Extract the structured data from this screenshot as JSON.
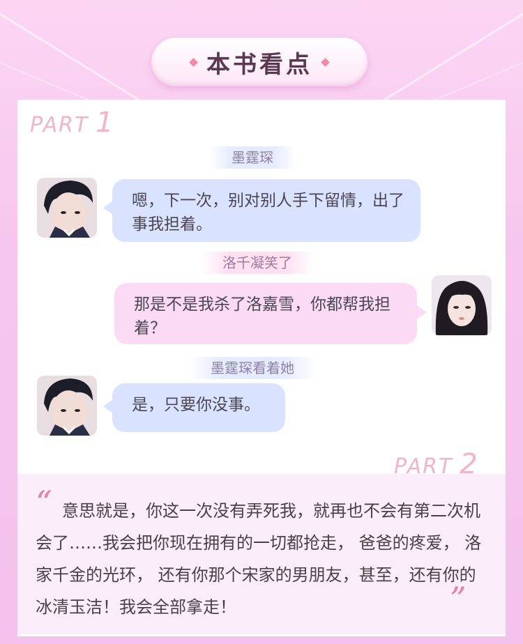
{
  "header": {
    "title": "本书看点"
  },
  "part1": {
    "label": "PART",
    "number": "1",
    "dialogues": [
      {
        "speaker_tag": "墨霆琛",
        "text": "嗯，下一次，别对别人手下留情，出了事我担着。",
        "side": "left",
        "avatar": "male-avatar"
      },
      {
        "speaker_tag": "洛千凝笑了",
        "text": "那是不是我杀了洛嘉雪，你都帮我担着？",
        "side": "right",
        "avatar": "female-avatar"
      },
      {
        "speaker_tag": "墨霆琛看着她",
        "text": "是，只要你没事。",
        "side": "left",
        "avatar": "male-avatar"
      }
    ]
  },
  "part2": {
    "label": "PART",
    "number": "2",
    "quote_open": "“",
    "quote_close": "”",
    "quote": "意思就是，你这一次没有弄死我，就再也不会有第二次机会了……我会把你现在拥有的一切都抢走， 爸爸的疼爱， 洛家千金的光环， 还有你那个宋家的男朋友，甚至，还有你的冰清玉洁！我会全部拿走！"
  },
  "colors": {
    "background": "#f6c6ee",
    "bubble_blue": "#d9e3ff",
    "bubble_pink": "#fbdaf3",
    "part_label": "#f3b3c8",
    "quote_mark": "#f07a9a"
  }
}
